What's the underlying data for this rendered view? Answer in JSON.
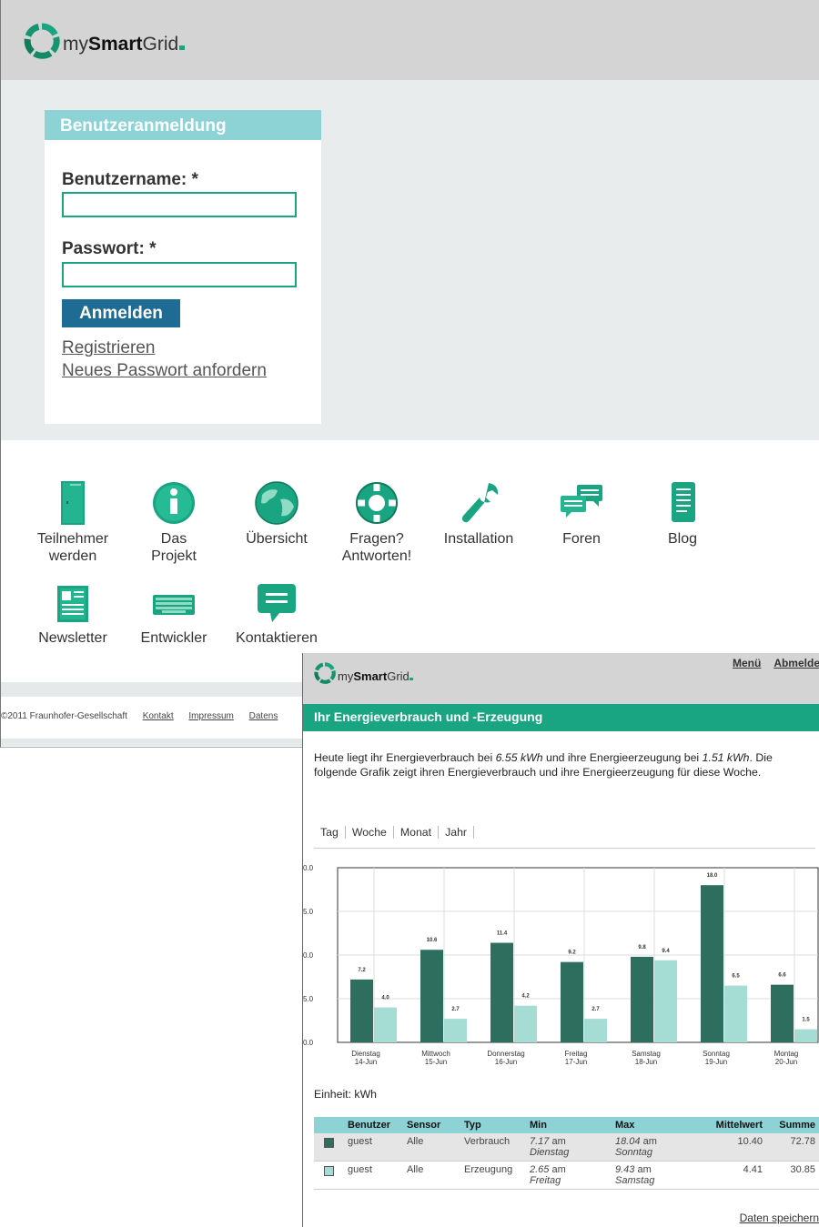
{
  "login_page": {
    "logo": {
      "prefix": "my",
      "bold": "Smart",
      "suffix": "Grid"
    },
    "login_box": {
      "title": "Benutzeranmeldung",
      "username_label": "Benutzername: *",
      "username_value": "",
      "password_label": "Passwort: *",
      "password_value": "",
      "submit_label": "Anmelden",
      "register_link": "Registrieren",
      "reset_link": "Neues Passwort anfordern"
    },
    "icons": [
      {
        "line1": "Teilnehmer",
        "line2": "werden",
        "icon": "door-icon"
      },
      {
        "line1": "Das",
        "line2": "Projekt",
        "icon": "info-icon"
      },
      {
        "line1": "Übersicht",
        "line2": "",
        "icon": "globe-icon"
      },
      {
        "line1": "Fragen?",
        "line2": "Antworten!",
        "icon": "lifebuoy-icon"
      },
      {
        "line1": "Installation",
        "line2": "",
        "icon": "wrench-icon"
      },
      {
        "line1": "Foren",
        "line2": "",
        "icon": "chat-bubbles-icon"
      },
      {
        "line1": "Blog",
        "line2": "",
        "icon": "scroll-icon"
      },
      {
        "line1": "Newsletter",
        "line2": "",
        "icon": "newspaper-icon"
      },
      {
        "line1": "Entwickler",
        "line2": "",
        "icon": "keyboard-icon"
      },
      {
        "line1": "Kontaktieren",
        "line2": "",
        "icon": "speech-bubble-icon"
      }
    ],
    "footer": {
      "copyright": "©2011 Fraunhofer-Gesellschaft",
      "links": [
        "Kontakt",
        "Impressum",
        "Datens"
      ]
    }
  },
  "energy_page": {
    "logo": {
      "prefix": "my",
      "bold": "Smart",
      "suffix": "Grid"
    },
    "menu": [
      "Menü",
      "Abmelde"
    ],
    "title": "Ihr Energieverbrauch und -Erzeugung",
    "intro": {
      "p1": "Heute liegt ihr Energieverbrauch bei ",
      "consumption": "6.55 kWh",
      "p2": " und ihre Energieerzeugung bei ",
      "production": "1.51 kWh",
      "p3": ". Die folgende Grafik zeigt ihren Energieverbrauch und ihre Energieerzeugung für diese Woche."
    },
    "tabs": [
      "Tag",
      "Woche",
      "Monat",
      "Jahr"
    ],
    "unit": "Einheit: kWh",
    "table": {
      "headers": [
        "Benutzer",
        "Sensor",
        "Typ",
        "Min",
        "Max",
        "Mittelwert",
        "Summe"
      ],
      "rows": [
        {
          "color": "#2e6e5f",
          "user": "guest",
          "sensor": "Alle",
          "type": "Verbrauch",
          "min": "7.17",
          "min_am": "am",
          "min_day": "Dienstag",
          "max": "18.04",
          "max_am": "am",
          "max_day": "Sonntag",
          "mean": "10.40",
          "sum": "72.78"
        },
        {
          "color": "#a5dcd4",
          "user": "guest",
          "sensor": "Alle",
          "type": "Erzeugung",
          "min": "2.65",
          "min_am": "am",
          "min_day": "Freitag",
          "max": "9.43",
          "max_am": "am",
          "max_day": "Samstag",
          "mean": "4.41",
          "sum": "30.85"
        }
      ]
    },
    "save_link": "Daten speichern"
  },
  "chart_data": {
    "type": "bar",
    "categories": [
      [
        "Dienstag",
        "14-Jun"
      ],
      [
        "Mittwoch",
        "15-Jun"
      ],
      [
        "Donnerstag",
        "16-Jun"
      ],
      [
        "Freitag",
        "17-Jun"
      ],
      [
        "Samstag",
        "18-Jun"
      ],
      [
        "Sonntag",
        "19-Jun"
      ],
      [
        "Montag",
        "20-Jun"
      ]
    ],
    "series": [
      {
        "values": [
          7.2,
          10.6,
          11.4,
          9.2,
          9.8,
          18.0,
          6.6
        ],
        "color": "#2e6e5f"
      },
      {
        "values": [
          4.0,
          2.7,
          4.2,
          2.7,
          9.4,
          6.5,
          1.5
        ],
        "color": "#a5dcd4"
      }
    ],
    "value_labels": [
      [
        "7.2",
        "10.6",
        "11.4",
        "9.2",
        "9.8",
        "18.0",
        "6.6"
      ],
      [
        "4.0",
        "2.7",
        "4.2",
        "2.7",
        "9.4",
        "6.5",
        "1.5"
      ]
    ],
    "ytick_labels": [
      "0.0",
      "5.0",
      "0.0",
      "5.0",
      "0.0"
    ],
    "yticks": [
      20,
      15,
      10,
      5,
      0
    ],
    "ylim": [
      0,
      20
    ],
    "grid": true
  },
  "colors": {
    "brand": "#1aa582",
    "header_light": "#8dd3d6",
    "button": "#1e6c94",
    "bar_dark": "#2e6e5f",
    "bar_light": "#a5dcd4"
  }
}
